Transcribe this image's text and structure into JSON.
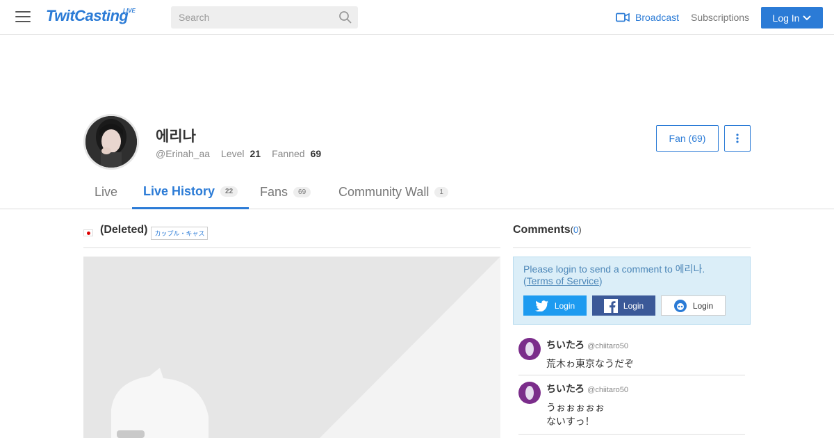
{
  "header": {
    "logo": "TwitCasting",
    "logo_sub": "LIVE",
    "search_placeholder": "Search",
    "broadcast": "Broadcast",
    "subscriptions": "Subscriptions",
    "login": "Log In",
    "accent_color": "#2b7bd6"
  },
  "profile": {
    "name": "에리나",
    "handle": "@Erinah_aa",
    "level_label": "Level",
    "level": "21",
    "fanned_label": "Fanned",
    "fanned": "69",
    "fan_button": "Fan (69)"
  },
  "tabs": [
    {
      "label": "Live",
      "count": ""
    },
    {
      "label": "Live History",
      "count": "22"
    },
    {
      "label": "Fans",
      "count": "69"
    },
    {
      "label": "Community Wall",
      "count": "1"
    }
  ],
  "movie": {
    "title": "(Deleted)",
    "tag": "カップル・キャス"
  },
  "comments": {
    "title": "Comments",
    "count_open": "(",
    "count": "0",
    "count_close": ")",
    "login_prompt": "Please login to send a comment to 에리나.",
    "tos_open": "(",
    "tos": "Terms of Service",
    "tos_close": ")",
    "twitter_login": "Login",
    "facebook_login": "Login",
    "twitcasting_login": "Login",
    "items": [
      {
        "name": "ちいたろ",
        "id": "@chiitaro50",
        "text": "荒木ゎ東京なうだぞ"
      },
      {
        "name": "ちいたろ",
        "id": "@chiitaro50",
        "text": "うぉぉぉぉぉ\nないすっ！"
      }
    ]
  }
}
